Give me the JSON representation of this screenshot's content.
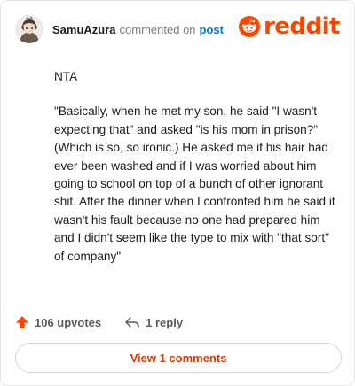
{
  "header": {
    "username": "SamuAzura",
    "action": "commented on",
    "post_link": "post",
    "logo_text": "reddit"
  },
  "comment": {
    "paragraphs": [
      "NTA",
      "\"Basically, when he met my son, he said \"I wasn't expecting that\" and asked \"is his mom in prison?\" (Which is so, so ironic.) He asked me if his hair had ever been washed and if I was worried about him going to school on top of a bunch of other ignorant shit. After the dinner when I confronted him he said it wasn't his fault because no one had prepared him and I didn't seem like the type to mix with \"that sort\" of company\""
    ]
  },
  "footer": {
    "upvotes_label": "106 upvotes",
    "reply_label": "1 reply"
  },
  "view_button": {
    "label": "View 1 comments"
  },
  "colors": {
    "brand": "#ff4500",
    "link": "#0079d3",
    "view_button_text": "#d93a00"
  },
  "icons": {
    "avatar": "user-avatar",
    "logo": "reddit-alien-icon",
    "upvote": "upvote-arrow-icon",
    "reply": "reply-arrow-icon"
  }
}
